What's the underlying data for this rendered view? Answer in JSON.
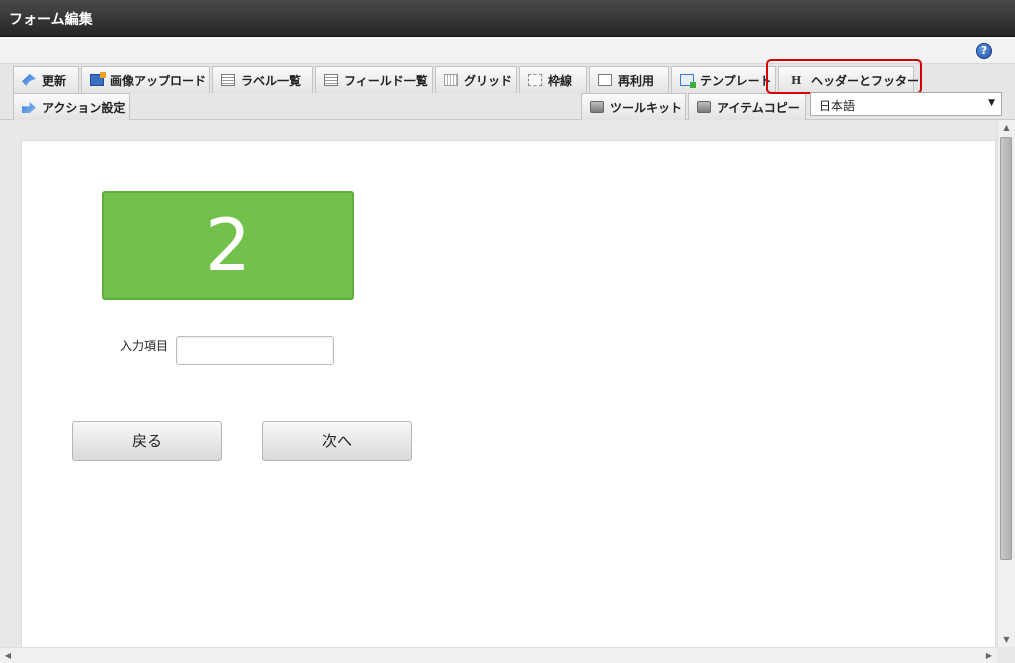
{
  "window": {
    "title": "フォーム編集"
  },
  "help": {
    "icon_glyph": "?"
  },
  "toolbar": {
    "row1": [
      {
        "id": "update",
        "label": "更新",
        "icon": "update-icon"
      },
      {
        "id": "image-upload",
        "label": "画像アップロード",
        "icon": "image-upload-icon"
      },
      {
        "id": "label-list",
        "label": "ラベル一覧",
        "icon": "list-icon"
      },
      {
        "id": "field-list",
        "label": "フィールド一覧",
        "icon": "list-icon"
      },
      {
        "id": "grid",
        "label": "グリッド",
        "icon": "grid-icon"
      },
      {
        "id": "frame-line",
        "label": "枠線",
        "icon": "frame-icon"
      },
      {
        "id": "reuse",
        "label": "再利用",
        "icon": "document-icon"
      },
      {
        "id": "template",
        "label": "テンプレート",
        "icon": "template-icon"
      },
      {
        "id": "header-footer",
        "label": "ヘッダーとフッター",
        "icon": "header-h-icon",
        "icon_glyph": "H",
        "highlighted": true
      }
    ],
    "row2_left": [
      {
        "id": "action-settings",
        "label": "アクション設定",
        "icon": "action-icon"
      }
    ],
    "row2_right": [
      {
        "id": "toolkit",
        "label": "ツールキット",
        "icon": "toolbox-icon"
      },
      {
        "id": "item-copy",
        "label": "アイテムコピー",
        "icon": "toolbox-icon"
      }
    ],
    "language": {
      "selected": "日本語",
      "arrow_glyph": "▼"
    }
  },
  "form": {
    "step_number": "2",
    "field_label": "入力項目",
    "field_value": "",
    "back_button": "戻る",
    "next_button": "次へ"
  },
  "scrollbars": {
    "up": "▲",
    "down": "▼",
    "left": "◀",
    "right": "▶"
  },
  "colors": {
    "step_box": "#72c14b",
    "highlight": "#d40000",
    "titlebar": "#2e2e2e"
  }
}
